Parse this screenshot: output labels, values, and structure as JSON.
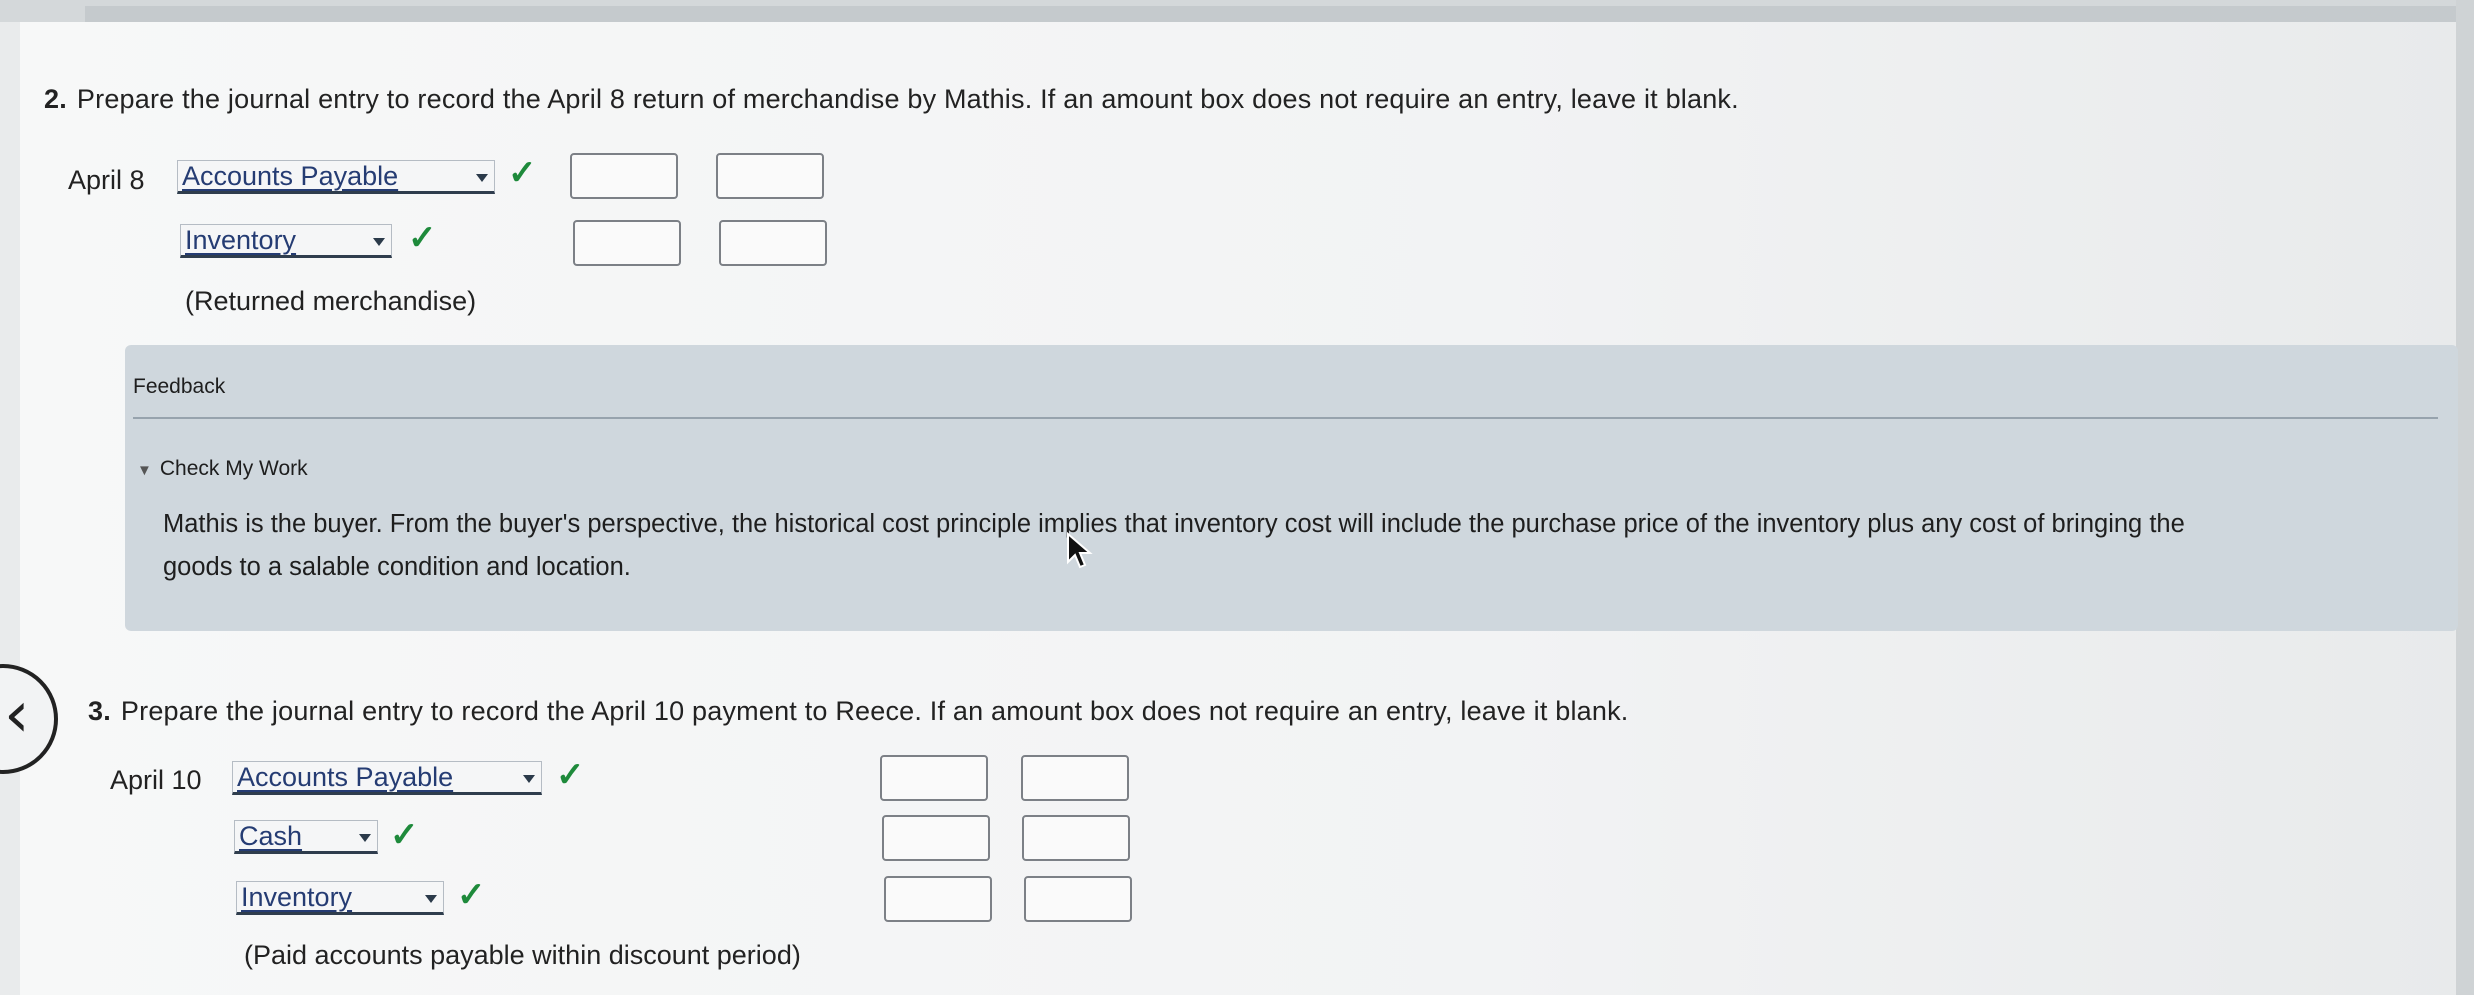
{
  "question2": {
    "number": "2.",
    "prompt": "Prepare the journal entry to record the April 8 return of merchandise by Mathis. If an amount box does not require an entry, leave it blank.",
    "date": "April 8",
    "lines": [
      {
        "account": "Accounts Payable",
        "status": "correct"
      },
      {
        "account": "Inventory",
        "status": "correct"
      }
    ],
    "memo": "(Returned merchandise)"
  },
  "feedback": {
    "title": "Feedback",
    "toggle_label": "Check My Work",
    "body_line1": "Mathis is the buyer. From the buyer's perspective, the historical cost principle implies that inventory cost will include the purchase price of the inventory plus any cost of bringing the",
    "body_line2": "goods to a salable condition and location."
  },
  "question3": {
    "number": "3.",
    "prompt": "Prepare the journal entry to record the April 10 payment to Reece. If an amount box does not require an entry, leave it blank.",
    "date": "April 10",
    "lines": [
      {
        "account": "Accounts Payable",
        "status": "correct"
      },
      {
        "account": "Cash",
        "status": "correct"
      },
      {
        "account": "Inventory",
        "status": "correct"
      }
    ],
    "memo": "(Paid accounts payable within discount period)"
  },
  "nav": {
    "back_icon": "chevron-left-icon"
  },
  "colors": {
    "check": "#1e8a3b",
    "select_text": "#253c73",
    "feedback_bg": "#cfd7dd"
  }
}
